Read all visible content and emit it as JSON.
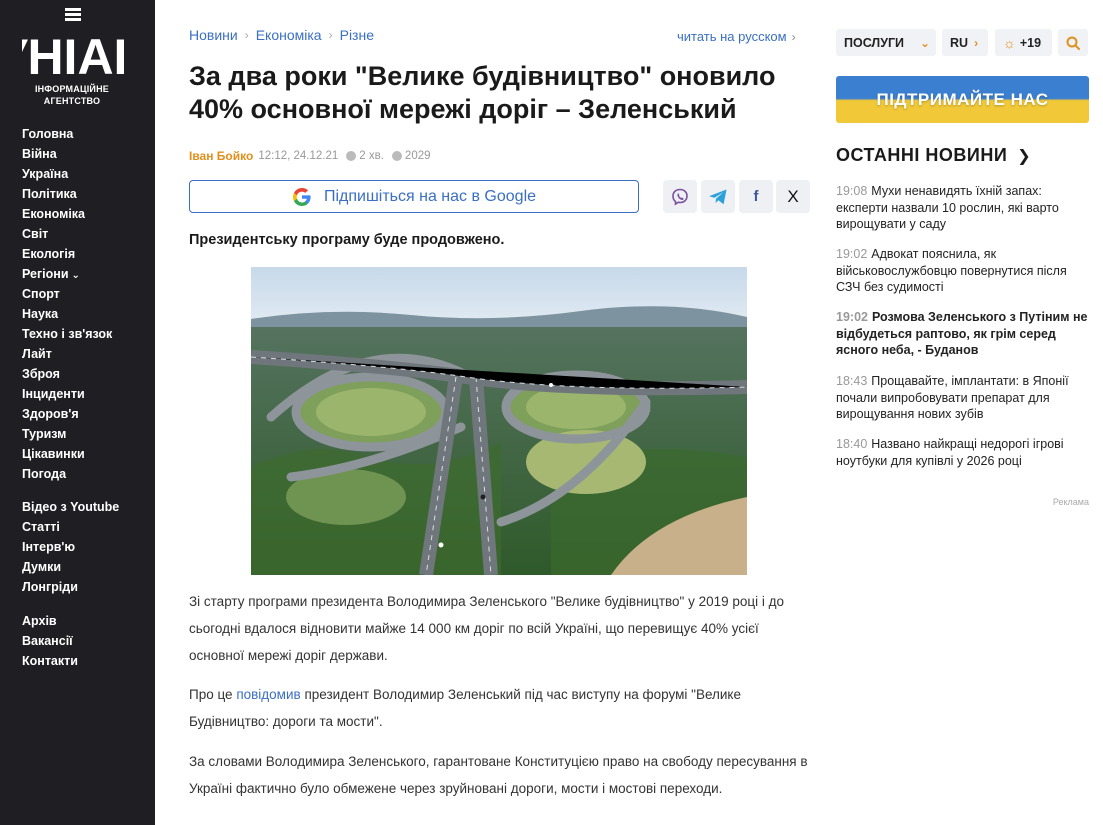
{
  "logo": {
    "wordmark": "УНІАН",
    "subtitle": "ІНФОРМАЦІЙНЕ АГЕНТСТВО"
  },
  "nav_primary": [
    "Головна",
    "Війна",
    "Україна",
    "Політика",
    "Економіка",
    "Світ",
    "Екологія",
    "Регіони",
    "Спорт",
    "Наука",
    "Техно і зв'язок",
    "Лайт",
    "Зброя",
    "Інциденти",
    "Здоров'я",
    "Туризм",
    "Цікавинки",
    "Погода"
  ],
  "nav_secondary": [
    "Відео з Youtube",
    "Статті",
    "Інтерв'ю",
    "Думки",
    "Лонгріди"
  ],
  "nav_tertiary": [
    "Архів",
    "Вакансії",
    "Контакти"
  ],
  "breadcrumbs": [
    "Новини",
    "Економіка",
    "Різне"
  ],
  "lang_link": "читать на русском",
  "article": {
    "title": "За два роки \"Велике будівництво\" оновило 40% основної мережі доріг – Зеленський",
    "author": "Іван Бойко",
    "datetime": "12:12, 24.12.21",
    "read_time": "2 хв.",
    "views": "2029",
    "google_cta": "Підпишіться на нас в Google",
    "lead": "Президентську програму буде продовжено.",
    "p1": "Зі старту програми президента Володимира Зеленського \"Велике будівництво\" у 2019 році і до сьогодні вдалося відновити майже 14 000 км доріг по всій Україні, що перевищує 40% усієї основної мережі доріг держави.",
    "p2_before": "Про це ",
    "p2_link": "повідомив",
    "p2_after": " президент Володимир Зеленський під час виступу на форумі  \"Велике Будівництво: дороги та мости\".",
    "p3": "За словами Володимира Зеленського, гарантоване Конституцією право на свободу пересування в Україні фактично було обмежене через зруйновані дороги, мости і мостові переходи."
  },
  "share": {
    "viber": "viber-icon",
    "telegram": "telegram-icon",
    "facebook": "f",
    "x": "X"
  },
  "header_right": {
    "services": "ПОСЛУГИ",
    "lang": "RU",
    "weather": "+19"
  },
  "support_banner": "ПІДТРИМАЙТЕ НАС",
  "latest": {
    "heading": "ОСТАННІ НОВИНИ",
    "items": [
      {
        "time": "19:08",
        "text": "Мухи ненавидять їхній запах: експерти назвали 10 рослин, які варто вирощувати у саду"
      },
      {
        "time": "19:02",
        "text": "Адвокат пояснила, як військовослужбовцю повернутися після СЗЧ без судимості"
      },
      {
        "time": "19:02",
        "text": "Розмова Зеленського з Путіним не відбудеться раптово, як грім серед ясного неба, - Буданов"
      },
      {
        "time": "18:43",
        "text": "Прощавайте, імплантати: в Японії почали випробовувати препарат для вирощування нових зубів"
      },
      {
        "time": "18:40",
        "text": "Названо найкращі недорогі ігрові ноутбуки для купівлі у 2026 році"
      }
    ]
  },
  "ad_label": "Реклама",
  "colors": {
    "sidebar_bg": "#1f1f23",
    "link": "#3a6fc4",
    "accent": "#e0901c"
  }
}
